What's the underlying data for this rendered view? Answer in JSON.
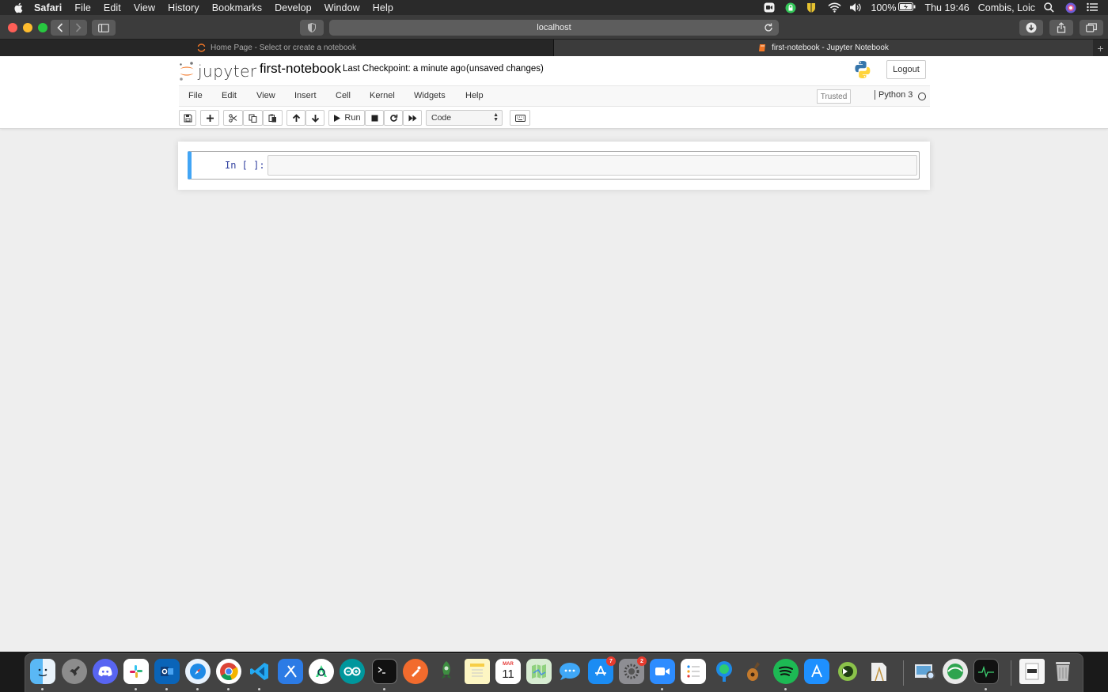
{
  "menubar": {
    "app_name": "Safari",
    "items": [
      "File",
      "Edit",
      "View",
      "History",
      "Bookmarks",
      "Develop",
      "Window",
      "Help"
    ],
    "battery": "100%",
    "clock": "Thu 19:46",
    "user": "Combis, Loic"
  },
  "browser": {
    "address": "localhost",
    "tabs": [
      {
        "title": "Home Page - Select or create a notebook"
      },
      {
        "title": "first-notebook - Jupyter Notebook"
      }
    ]
  },
  "jupyter": {
    "logo_text": "jupyter",
    "notebook_name": "first-notebook",
    "checkpoint": "Last Checkpoint: a minute ago",
    "unsaved": "(unsaved changes)",
    "logout_label": "Logout",
    "menus": [
      "File",
      "Edit",
      "View",
      "Insert",
      "Cell",
      "Kernel",
      "Widgets",
      "Help"
    ],
    "trusted_label": "Trusted",
    "kernel_name": "Python 3",
    "toolbar": {
      "run_label": "Run",
      "cell_type": "Code"
    },
    "cell": {
      "prompt": "In [ ]:",
      "content": ""
    }
  },
  "dock": {
    "badges": {
      "app_store": "7",
      "system_prefs": "2"
    },
    "calendar": {
      "month": "MAR",
      "day": "11"
    }
  }
}
